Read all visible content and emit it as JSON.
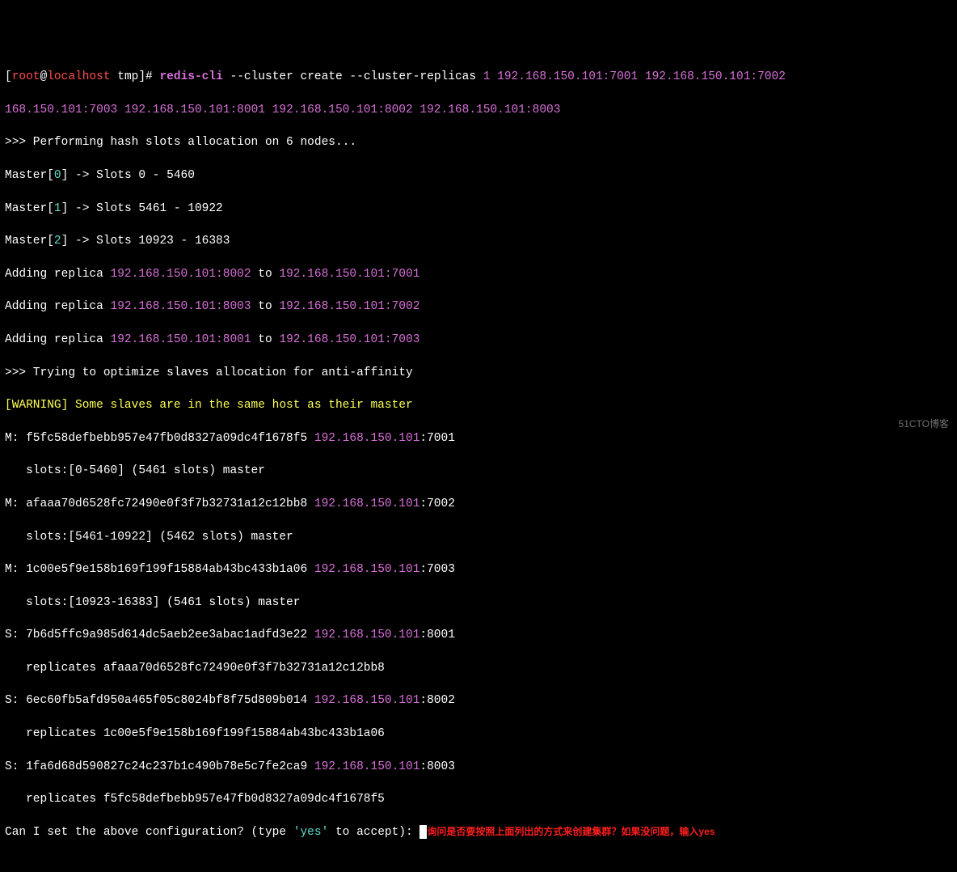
{
  "prompt": {
    "open": "[",
    "user": "root",
    "at": "@",
    "host": "localhost",
    "dir": " tmp",
    "close": "]# "
  },
  "cmd": {
    "exe": "redis-cli",
    "args_a": " --cluster create --cluster-replicas ",
    "one": "1",
    "sp": " ",
    "n1": "192.168.150.101:7001",
    "n2": "192.168.150.101:7002 ",
    "n3_ip": "168.150.101:7003",
    "n4": "192.168.150.101:8001",
    "n5": "192.168.150.101:8002",
    "n6": "192.168.150.101:8003"
  },
  "out": {
    "perf": ">>> Performing hash slots allocation on 6 nodes...",
    "m0a": "Master[",
    "m0b": "0",
    "m0c": "] -> Slots 0 - 5460",
    "m1a": "Master[",
    "m1b": "1",
    "m1c": "] -> Slots 5461 - 10922",
    "m2a": "Master[",
    "m2b": "2",
    "m2c": "] -> Slots 10923 - 16383",
    "add": "Adding replica ",
    "to": " to ",
    "r1s": "192.168.150.101:8002",
    "r1d": "192.168.150.101:7001",
    "r2s": "192.168.150.101:8003",
    "r2d": "192.168.150.101:7002",
    "r3s": "192.168.150.101:8001",
    "r3d": "192.168.150.101:7003",
    "opt": ">>> Trying to optimize slaves allocation for anti-affinity",
    "warn": "[WARNING] Some slaves are in the same host as their master",
    "M": "M: ",
    "S": "S: ",
    "h1": "f5fc58defbebb957e47fb0d8327a09dc4f1678f5 ",
    "a1": "192.168.150.101",
    "p1": ":7001",
    "s1": "   slots:[0-5460] (5461 slots) master",
    "h2": "afaaa70d6528fc72490e0f3f7b32731a12c12bb8 ",
    "a2": "192.168.150.101",
    "p2": ":7002",
    "s2": "   slots:[5461-10922] (5462 slots) master",
    "h3": "1c00e5f9e158b169f199f15884ab43bc433b1a06 ",
    "a3": "192.168.150.101",
    "p3": ":7003",
    "s3": "   slots:[10923-16383] (5461 slots) master",
    "h4": "7b6d5ffc9a985d614dc5aeb2ee3abac1adfd3e22 ",
    "a4": "192.168.150.101",
    "p4": ":8001",
    "r4": "   replicates afaaa70d6528fc72490e0f3f7b32731a12c12bb8",
    "h5": "6ec60fb5afd950a465f05c8024bf8f75d809b014 ",
    "a5": "192.168.150.101",
    "p5": ":8002",
    "r5": "   replicates 1c00e5f9e158b169f199f15884ab43bc433b1a06",
    "h6": "1fa6d68d590827c24c237b1c490b78e5c7fe2ca9 ",
    "a6": "192.168.150.101",
    "p6": ":8003",
    "r6": "   replicates f5fc58defbebb957e47fb0d8327a09dc4f1678f5",
    "q1": "Can I set the above configuration? (type ",
    "q2": "'yes'",
    "q3": " to accept): "
  },
  "annot": "询问是否要按照上面列出的方式来创建集群？如果没问题，输入yes",
  "watermark": "51CTO博客"
}
